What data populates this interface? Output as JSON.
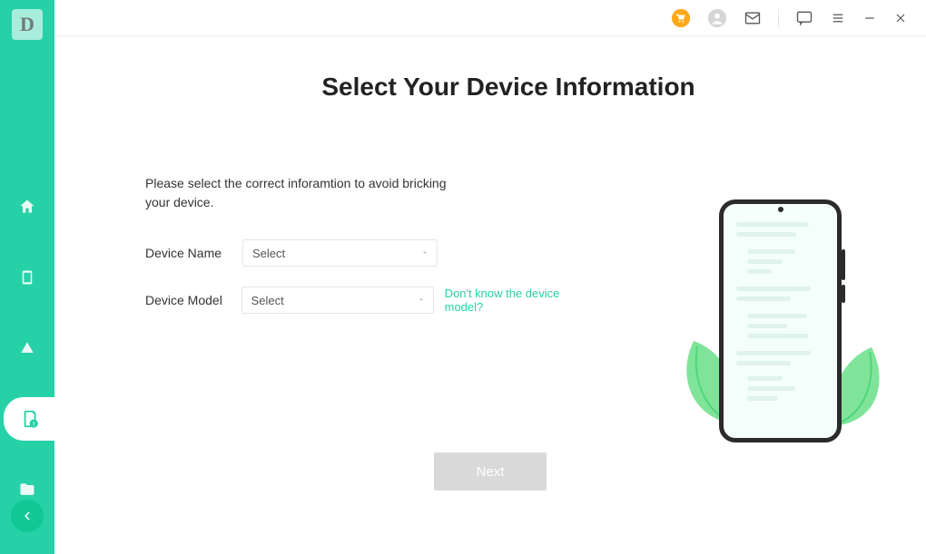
{
  "app_logo_letter": "D",
  "sidebar": {
    "items": [
      {
        "name": "home"
      },
      {
        "name": "device"
      },
      {
        "name": "cloud"
      },
      {
        "name": "recover-warning"
      },
      {
        "name": "folder"
      }
    ],
    "active_index": 3
  },
  "topbar": {
    "cart": "cart-icon",
    "user": "user-icon",
    "mail": "mail-icon",
    "feedback": "feedback-icon",
    "menu": "menu-icon",
    "minimize": "minimize-icon",
    "close": "close-icon"
  },
  "page": {
    "title": "Select Your Device Information",
    "instruction": "Please select the correct inforamtion to avoid bricking your device.",
    "device_name_label": "Device Name",
    "device_name_value": "Select",
    "device_model_label": "Device Model",
    "device_model_value": "Select",
    "help_link": "Don't know the device model?",
    "next_button": "Next"
  }
}
